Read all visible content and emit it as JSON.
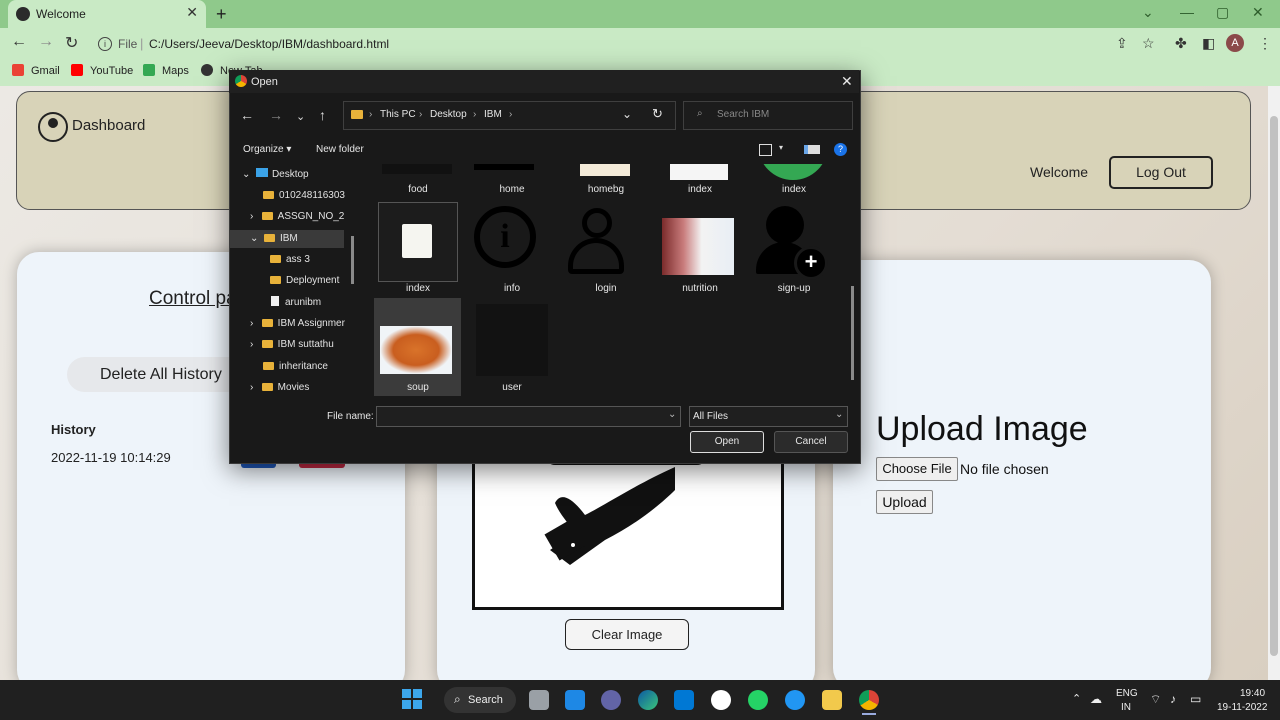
{
  "browser": {
    "tab_title": "Welcome",
    "url_scheme": "File",
    "url": "C:/Users/Jeeva/Desktop/IBM/dashboard.html",
    "avatar_letter": "A",
    "bookmarks": [
      "Gmail",
      "YouTube",
      "Maps",
      "New Tab"
    ]
  },
  "header": {
    "title": "Dashboard",
    "welcome": "Welcome",
    "logout": "Log Out"
  },
  "control_panel": {
    "title": "Control panel",
    "delete_button": "Delete All History",
    "history_label": "History",
    "history_items": [
      "2022-11-19 10:14:29"
    ]
  },
  "image_panel": {
    "clear_button": "Clear Image"
  },
  "upload_panel": {
    "title": "Upload Image",
    "choose_button": "Choose File",
    "no_file": "No file chosen",
    "upload_button": "Upload"
  },
  "dialog": {
    "title": "Open",
    "breadcrumb": [
      "This PC",
      "Desktop",
      "IBM"
    ],
    "search_placeholder": "Search IBM",
    "organize": "Organize",
    "new_folder": "New folder",
    "nav_items": [
      {
        "label": "Desktop"
      },
      {
        "label": "010248116303"
      },
      {
        "label": "ASSGN_NO_2"
      },
      {
        "label": "IBM"
      },
      {
        "label": "ass 3"
      },
      {
        "label": "Deployment"
      },
      {
        "label": "arunibm"
      },
      {
        "label": "IBM Assignmer"
      },
      {
        "label": "IBM suttathu"
      },
      {
        "label": "inheritance"
      },
      {
        "label": "Movies"
      }
    ],
    "files_row1": [
      "food",
      "home",
      "homebg",
      "index",
      "index"
    ],
    "files_row2": [
      "index",
      "info",
      "login",
      "nutrition",
      "sign-up"
    ],
    "files_row3": [
      "soup",
      "user"
    ],
    "file_name_label": "File name:",
    "file_name_value": "",
    "filter": "All Files",
    "open_button": "Open",
    "cancel_button": "Cancel"
  },
  "taskbar": {
    "search": "Search",
    "lang_top": "ENG",
    "lang_bottom": "IN",
    "time": "19:40",
    "date": "19-11-2022"
  }
}
